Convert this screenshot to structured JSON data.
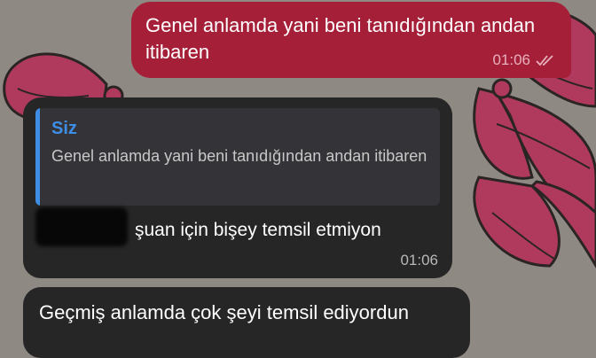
{
  "colors": {
    "outgoing_bubble": "#a51f38",
    "incoming_bubble": "#262626",
    "quote_accent": "#3e8ee5",
    "wallpaper": "#8f8984",
    "wallpaper_bow": "#b03a5e"
  },
  "messages": [
    {
      "direction": "outgoing",
      "text": "Genel anlamda yani beni tanıdığından andan itibaren",
      "time": "01:06",
      "status_icon": "double-check-icon"
    },
    {
      "direction": "incoming",
      "reply_to": {
        "author": "Siz",
        "text": "Genel anlamda yani beni tanıdığından andan itibaren"
      },
      "text": "şuan için bişey temsil etmiyon",
      "time": "01:06"
    },
    {
      "direction": "incoming",
      "text": "Geçmiş anlamda çok şeyi temsil ediyordun"
    }
  ]
}
